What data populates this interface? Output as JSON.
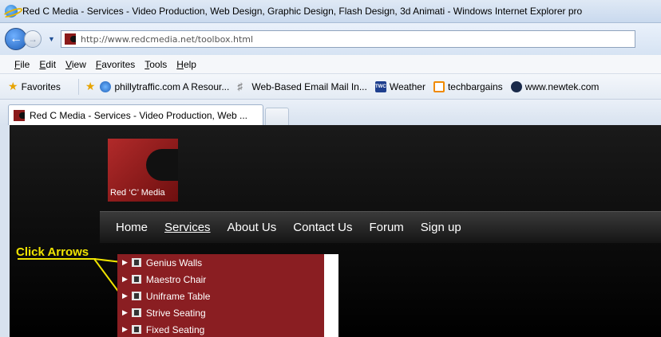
{
  "window": {
    "title": "Red C Media - Services - Video Production, Web Design, Graphic Design, Flash Design, 3d Animati - Windows Internet Explorer pro"
  },
  "address_bar": {
    "url": "http://www.redcmedia.net/toolbox.html"
  },
  "menu": {
    "items": [
      "File",
      "Edit",
      "View",
      "Favorites",
      "Tools",
      "Help"
    ]
  },
  "favorites_bar": {
    "label": "Favorites",
    "links": [
      {
        "label": "phillytraffic.com A Resour...",
        "icon": "ie-page-icon"
      },
      {
        "label": "Web-Based Email Mail In...",
        "icon": "mail-icon"
      },
      {
        "label": "Weather",
        "icon": "twc-icon"
      },
      {
        "label": "techbargains",
        "icon": "techbargains-icon"
      },
      {
        "label": "www.newtek.com",
        "icon": "newtek-icon"
      }
    ]
  },
  "tabs": [
    {
      "label": "Red C Media - Services - Video Production, Web ..."
    }
  ],
  "site": {
    "logo_text": "Red ‘C’ Media",
    "nav": [
      "Home",
      "Services",
      "About Us",
      "Contact Us",
      "Forum",
      "Sign up"
    ],
    "active_nav": "Services",
    "annotation": "Click Arrows",
    "dropdown": [
      "Genius Walls",
      "Maestro Chair",
      "Uniframe Table",
      "Strive Seating",
      "Fixed Seating"
    ]
  },
  "colors": {
    "brand_red": "#8a1e22",
    "annotation_yellow": "#f0e400"
  }
}
